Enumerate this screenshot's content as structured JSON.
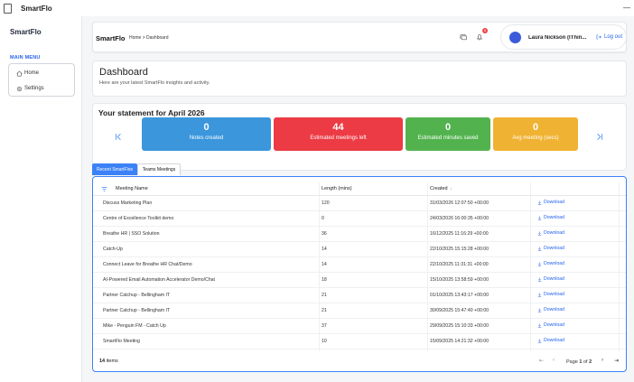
{
  "window": {
    "title": "SmartFlo",
    "minimize": "—"
  },
  "sidebar": {
    "brand": "SmartFlo",
    "menu_title": "MAIN MENU",
    "items": [
      {
        "label": "Home",
        "icon": "home-icon"
      },
      {
        "label": "Settings",
        "icon": "gear-icon"
      }
    ]
  },
  "header": {
    "logo": "SmartFlo",
    "breadcrumb": "Home > Dashboard",
    "notification_count": "6",
    "user_name": "Laura Nickson (IThin...",
    "logout_label": "Log out"
  },
  "dashboard": {
    "title": "Dashboard",
    "subtitle": "Here are your latest SmartFlo insights and activity."
  },
  "statement": {
    "title": "Your statement for April 2026",
    "stats": [
      {
        "value": "0",
        "label": "Notes created",
        "color": "#3b96dc"
      },
      {
        "value": "44",
        "label": "Estimated meetings left",
        "color": "#ec3b44"
      },
      {
        "value": "0",
        "label": "Estimated minutes saved",
        "color": "#52b34e"
      },
      {
        "value": "0",
        "label": "Avg meeting (secs)",
        "color": "#f0b232"
      }
    ]
  },
  "tabs": [
    {
      "label": "Recent SmartFlos",
      "active": true
    },
    {
      "label": "Teams Meetings",
      "active": false
    }
  ],
  "table": {
    "columns": [
      "Meeting Name",
      "Length (mins)",
      "Created"
    ],
    "sort_indicator": "↓",
    "rows": [
      {
        "name": "Discuss Marketing Plan",
        "length": "120",
        "created": "31/03/2026 12:07:50 +00:00",
        "action": "Download"
      },
      {
        "name": "Centre of Excellence Toolkit demo",
        "length": "0",
        "created": "24/03/2026 16:00:35 +00:00",
        "action": "Download"
      },
      {
        "name": "Breathe HR | SSO Solution",
        "length": "36",
        "created": "16/12/2025 11:16:29 +00:00",
        "action": "Download"
      },
      {
        "name": "Catch-Up",
        "length": "14",
        "created": "22/10/2025 15:15:28 +00:00",
        "action": "Download"
      },
      {
        "name": "Connect Leave for Breathe HR Chat/Demo",
        "length": "14",
        "created": "22/10/2025 11:31:31 +00:00",
        "action": "Download"
      },
      {
        "name": "AI-Powered Email Automation Accelerator Demo/Chat",
        "length": "18",
        "created": "15/10/2025 13:58:59 +00:00",
        "action": "Download"
      },
      {
        "name": "Partner Catchup - Bellingham IT",
        "length": "21",
        "created": "01/10/2025 13:43:17 +00:00",
        "action": "Download"
      },
      {
        "name": "Partner Catchup - Bellingham IT",
        "length": "21",
        "created": "30/09/2025 15:47:40 +00:00",
        "action": "Download"
      },
      {
        "name": "Mike - Penguin FM - Catch Up",
        "length": "37",
        "created": "29/09/2025 15:10:33 +00:00",
        "action": "Download"
      },
      {
        "name": "SmartFlo Meeting",
        "length": "10",
        "created": "15/09/2025 14:21:32 +00:00",
        "action": "Download"
      }
    ],
    "footer": {
      "count": "14",
      "count_label": "items",
      "page_label": "Page",
      "page": "1",
      "of_label": "of",
      "pages": "2"
    }
  }
}
